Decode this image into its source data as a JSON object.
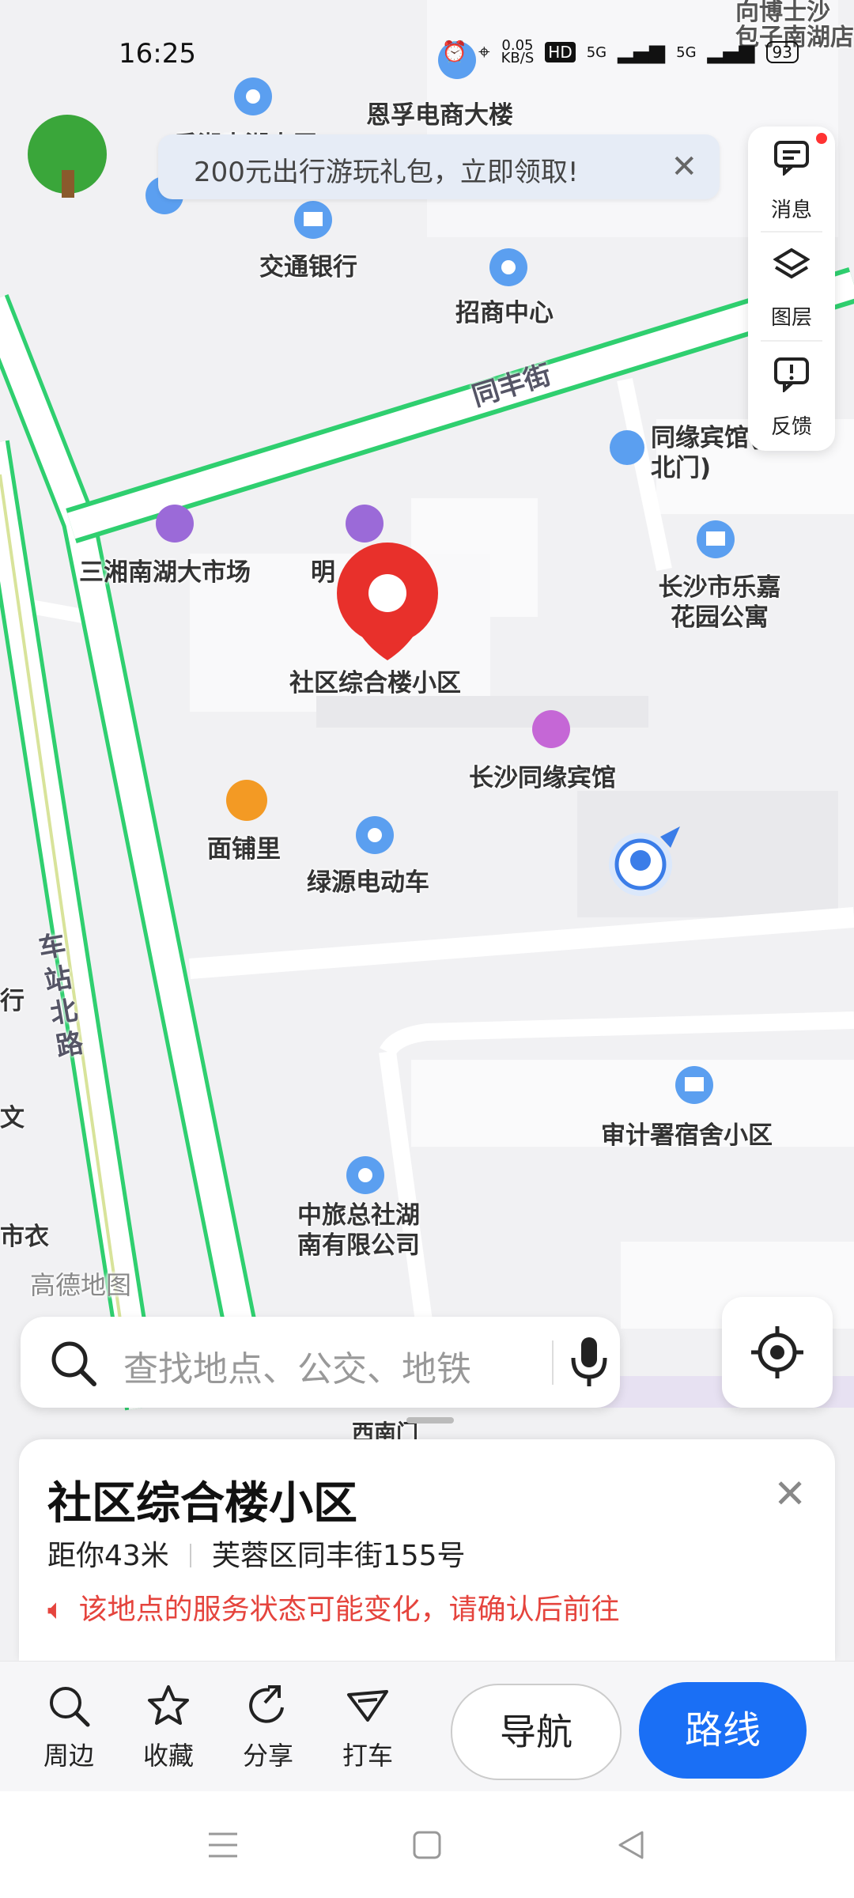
{
  "status_bar": {
    "time": "16:25",
    "net_speed": "0.05",
    "net_unit": "KB/S",
    "hd": "HD",
    "sig1": "5G",
    "sig2": "5G",
    "battery": "93"
  },
  "banner": {
    "text": "200元出行游玩礼包，立即领取!"
  },
  "right_tools": [
    {
      "label": "消息",
      "icon": "message-icon"
    },
    {
      "label": "图层",
      "icon": "layers-icon"
    },
    {
      "label": "反馈",
      "icon": "feedback-icon"
    }
  ],
  "map": {
    "road_labels": {
      "tongfeng_street": "同丰街",
      "chezhan_road": "车站北路"
    },
    "pois": {
      "enfu_building": "恩孚电商大楼",
      "bocom": "交通银行",
      "zhaoshang": "招商中心",
      "xiangnan_market": "三湘南湖大市场",
      "ming_partial": "明",
      "tongyuan_hotel_nw": "同缘宾馆(西北门)",
      "lejia_apartment": "长沙市乐嘉花园公寓",
      "selected_place": "社区综合楼小区",
      "tongyuan_hotel": "长沙同缘宾馆",
      "mianpuli": "面铺里",
      "lvyuan_ev": "绿源电动车",
      "audit_dorm": "审计署宿舍小区",
      "cts_hunan": "中旅总社湖南有限公司",
      "west_south_gate": "西南门",
      "nanhu_partial": "包子南湖店",
      "top_partial": "向博士沙",
      "left_hang": "行",
      "left_wen": "文",
      "left_shiyi": "市衣",
      "left_top_partial": "香湘南湖大厦"
    },
    "watermark": "高德地图"
  },
  "search": {
    "placeholder": "查找地点、公交、地铁"
  },
  "place_card": {
    "title": "社区综合楼小区",
    "distance": "距你43米",
    "address": "芙蓉区同丰街155号",
    "notice": "该地点的服务状态可能变化，请确认后前往"
  },
  "actions": [
    {
      "label": "周边",
      "icon": "search-nearby-icon"
    },
    {
      "label": "收藏",
      "icon": "star-icon"
    },
    {
      "label": "分享",
      "icon": "share-icon"
    },
    {
      "label": "打车",
      "icon": "taxi-icon"
    }
  ],
  "buttons": {
    "navigate": "导航",
    "route": "路线"
  },
  "colors": {
    "accent": "#1a6ff5",
    "marker": "#e8302b",
    "road_green": "#2fcf6f",
    "warning": "#e5443d"
  }
}
